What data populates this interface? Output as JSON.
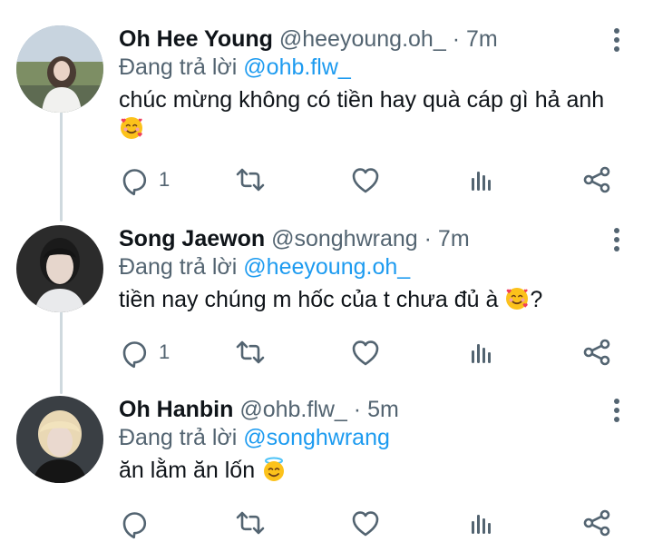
{
  "reply_prefix": "Đang trả lời",
  "tweets": [
    {
      "name": "Oh Hee Young",
      "handle": "@heeyoung.oh_",
      "separator": "·",
      "time": "7m",
      "reply_to": "@ohb.flw_",
      "text": "chúc mừng không có tiền hay quà cáp gì hả anh",
      "emoji": "smiling-face-with-hearts",
      "reply_count": "1"
    },
    {
      "name": "Song Jaewon",
      "handle": "@songhwrang",
      "separator": "·",
      "time": "7m",
      "reply_to": "@heeyoung.oh_",
      "text": "tiền nay chúng m hốc của t chưa đủ à",
      "text_after": "?",
      "emoji": "smiling-face-with-hearts",
      "reply_count": "1"
    },
    {
      "name": "Oh Hanbin",
      "handle": "@ohb.flw_",
      "separator": "·",
      "time": "5m",
      "reply_to": "@songhwrang",
      "text": "ăn lằm ăn lốn",
      "emoji": "smiling-face-with-halo",
      "reply_count": ""
    }
  ],
  "colors": {
    "text": "#0f1419",
    "secondary": "#536471",
    "link": "#1d9bf0",
    "thread_line": "#cfd9de"
  }
}
